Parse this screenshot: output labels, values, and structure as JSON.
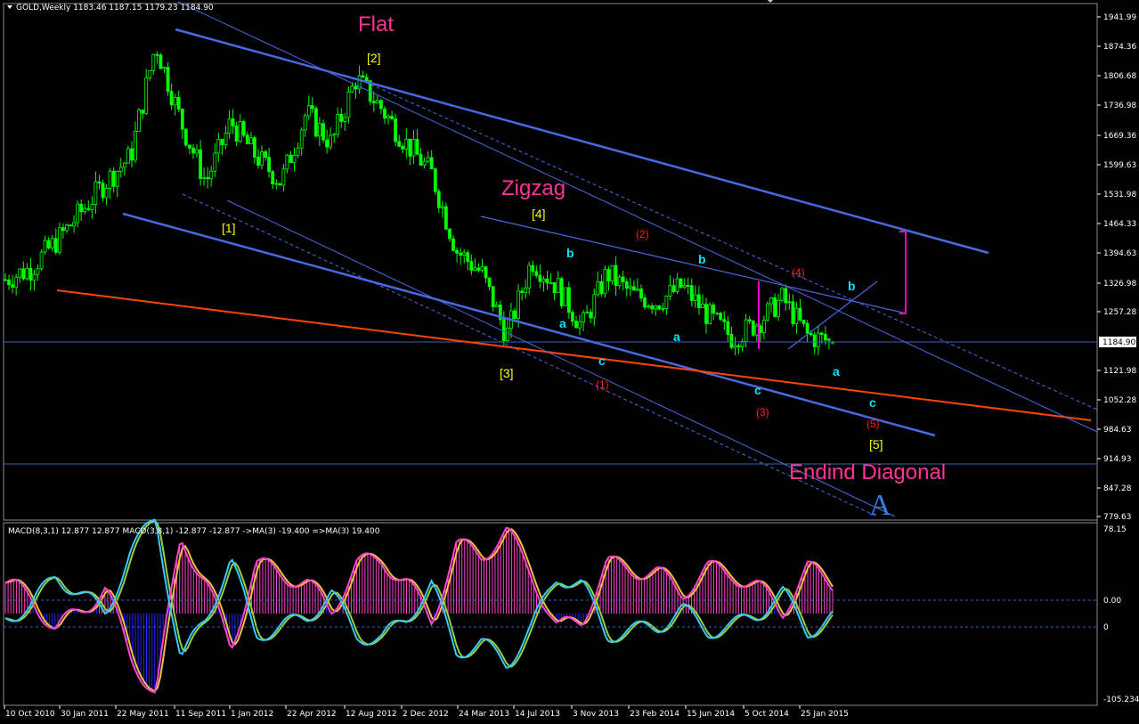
{
  "symbol_header": {
    "text": "GOLD,Weekly  1183.46 1187.15 1179.23 1184.90",
    "dropdown_icon": "triangle-down-icon"
  },
  "macd_header": {
    "text": "MACD(8,3,1) 12.877 12.877  MACD(3,8,1) -12.877 -12.877  ->MA(3) -19.400  =>MA(3) 19.400"
  },
  "price_axis": {
    "ticks": [
      "1941.99",
      "1874.36",
      "1806.68",
      "1736.98",
      "1669.36",
      "1599.63",
      "1531.98",
      "1464.33",
      "1394.63",
      "1326.98",
      "1257.28",
      "1184.90",
      "1121.98",
      "1052.28",
      "984.63",
      "914.93",
      "847.28",
      "779.63"
    ],
    "current_price": "1184.90",
    "range": [
      747,
      1975
    ]
  },
  "macd_axis": {
    "ticks": [
      "78.15",
      "0.00",
      "0",
      "-105.234"
    ],
    "range": [
      -105.234,
      78.15
    ]
  },
  "time_axis": {
    "labels": [
      "10 Oct 2010",
      "30 Jan 2011",
      "22 May 2011",
      "11 Sep 2011",
      "1 Jan 2012",
      "22 Apr 2012",
      "12 Aug 2012",
      "2 Dec 2012",
      "24 Mar 2013",
      "14 Jul 2013",
      "3 Nov 2013",
      "23 Feb 2014",
      "15 Jun 2014",
      "5 Oct 2014",
      "25 Jan 2015"
    ]
  },
  "colors": {
    "background": "#000000",
    "candles": "#00ff00",
    "channel_lines": "#4169e1",
    "orange_line": "#ff4500",
    "magenta": "#ff00cc",
    "pattern_text": "#ff3399",
    "yellow_labels": "#ffff00",
    "cyan_labels": "#00e5ff",
    "red_labels": "#ff2020",
    "macd_fast": "#ff44cc",
    "macd_slow": "#33ccff",
    "macd_ma": "#f0c040",
    "hist_pos": "#ff44cc",
    "hist_neg": "#2222ff"
  },
  "annotations": {
    "pattern_names": {
      "flat": "Flat",
      "zigzag": "Zigzag",
      "ending_diagonal": "Endind Diagonal"
    },
    "wave_A": "A",
    "yellow_labels": [
      "[1]",
      "[2]",
      "[3]",
      "[4]",
      "[5]"
    ],
    "cyan_labels": [
      "a",
      "b",
      "c"
    ],
    "red_labels": [
      "(1)",
      "(2)",
      "(3)",
      "(4)",
      "(5)"
    ]
  },
  "chart_data": {
    "type": "candlestick",
    "title": "GOLD,Weekly",
    "last_bar": {
      "open": 1183.46,
      "high": 1187.15,
      "low": 1179.23,
      "close": 1184.9
    },
    "x": [
      "2010-10-10",
      "2011-01-30",
      "2011-05-22",
      "2011-09-11",
      "2012-01-01",
      "2012-04-22",
      "2012-08-12",
      "2012-12-02",
      "2013-03-24",
      "2013-07-14",
      "2013-11-03",
      "2014-02-23",
      "2014-06-15",
      "2014-10-05",
      "2015-01-25"
    ],
    "close_path": [
      1335,
      1360,
      1420,
      1490,
      1560,
      1620,
      1880,
      1700,
      1560,
      1700,
      1620,
      1560,
      1720,
      1650,
      1800,
      1730,
      1650,
      1580,
      1400,
      1350,
      1200,
      1380,
      1320,
      1220,
      1350,
      1300,
      1280,
      1320,
      1250,
      1195,
      1230,
      1290,
      1200,
      1184.9
    ],
    "series": [
      {
        "name": "MACD(8,3,1)",
        "last": 12.877
      },
      {
        "name": "MACD(3,8,1)",
        "last": -12.877
      },
      {
        "name": "->MA(3)",
        "last": -19.4
      },
      {
        "name": "=>MA(3)",
        "last": 19.4
      }
    ],
    "macd_fast": [
      20,
      5,
      -30,
      -10,
      15,
      -60,
      -100,
      70,
      20,
      -50,
      40,
      30,
      20,
      -10,
      40,
      45,
      20,
      -20,
      60,
      50,
      75,
      30,
      -30,
      -20,
      40,
      35,
      30,
      10,
      35,
      30,
      15,
      -10,
      35,
      20
    ],
    "macd_ylim": [
      -105.234,
      78.15
    ],
    "ylim": [
      747,
      1975
    ]
  }
}
